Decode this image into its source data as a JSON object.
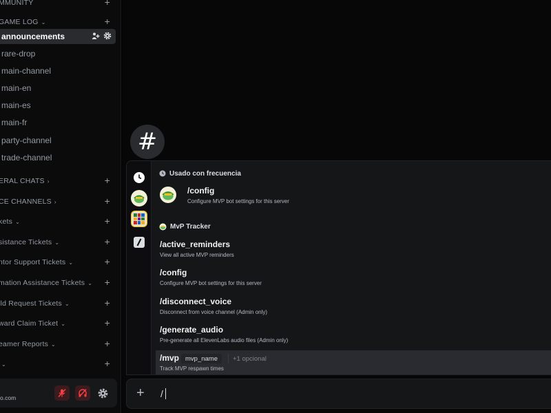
{
  "sidebar": {
    "categories": {
      "community": "MMUNITY",
      "game_log": "GAME LOG",
      "general_chats": "ERAL CHATS",
      "voice_channels": "CE CHANNELS",
      "tickets": "kets",
      "assistance_tickets": "sistance Tickets",
      "mentor_support_tickets": "ntor Support Tickets",
      "information_assistance_tickets": "mation Assistance Tickets",
      "build_request_tickets": "ild Request Tickets",
      "reward_claim_ticket": "ward Claim Ticket",
      "streamer_reports": "eamer Reports",
      "last": ""
    },
    "channels": {
      "announcements": "announcements",
      "rare_drop": "rare-drop",
      "main_channel": "main-channel",
      "main_en": "main-en",
      "main_es": "main-es",
      "main_fr": "main-fr",
      "party_channel": "party-channel",
      "trade_channel": "trade-channel"
    },
    "user_panel": {
      "subtext": "o.com"
    }
  },
  "autocomplete": {
    "frequent_header": "Usado con frecuencia",
    "frequent_command": {
      "name": "/config",
      "description": "Configure MVP bot settings for this server"
    },
    "bot_header": "MvP Tracker",
    "commands": [
      {
        "name": "/active_reminders",
        "description": "View all active MVP reminders"
      },
      {
        "name": "/config",
        "description": "Configure MVP bot settings for this server"
      },
      {
        "name": "/disconnect_voice",
        "description": "Disconnect from voice channel (Admin only)"
      },
      {
        "name": "/generate_audio",
        "description": "Pre-generate all ElevenLabs audio files (Admin only)"
      }
    ],
    "selected_command": {
      "name": "/mvp",
      "param": "mvp_name",
      "optional": "+1 opcional",
      "description": "Track MVP respawn times"
    }
  },
  "composer": {
    "typed_text": "/"
  },
  "icons": {
    "hash": "#",
    "plus": "+"
  },
  "colors": {
    "background": "#000000",
    "sidebar": "#0b0b0c",
    "active_channel": "#2a2b2f",
    "popup": "#151618",
    "muted_red": "#f23f43"
  }
}
